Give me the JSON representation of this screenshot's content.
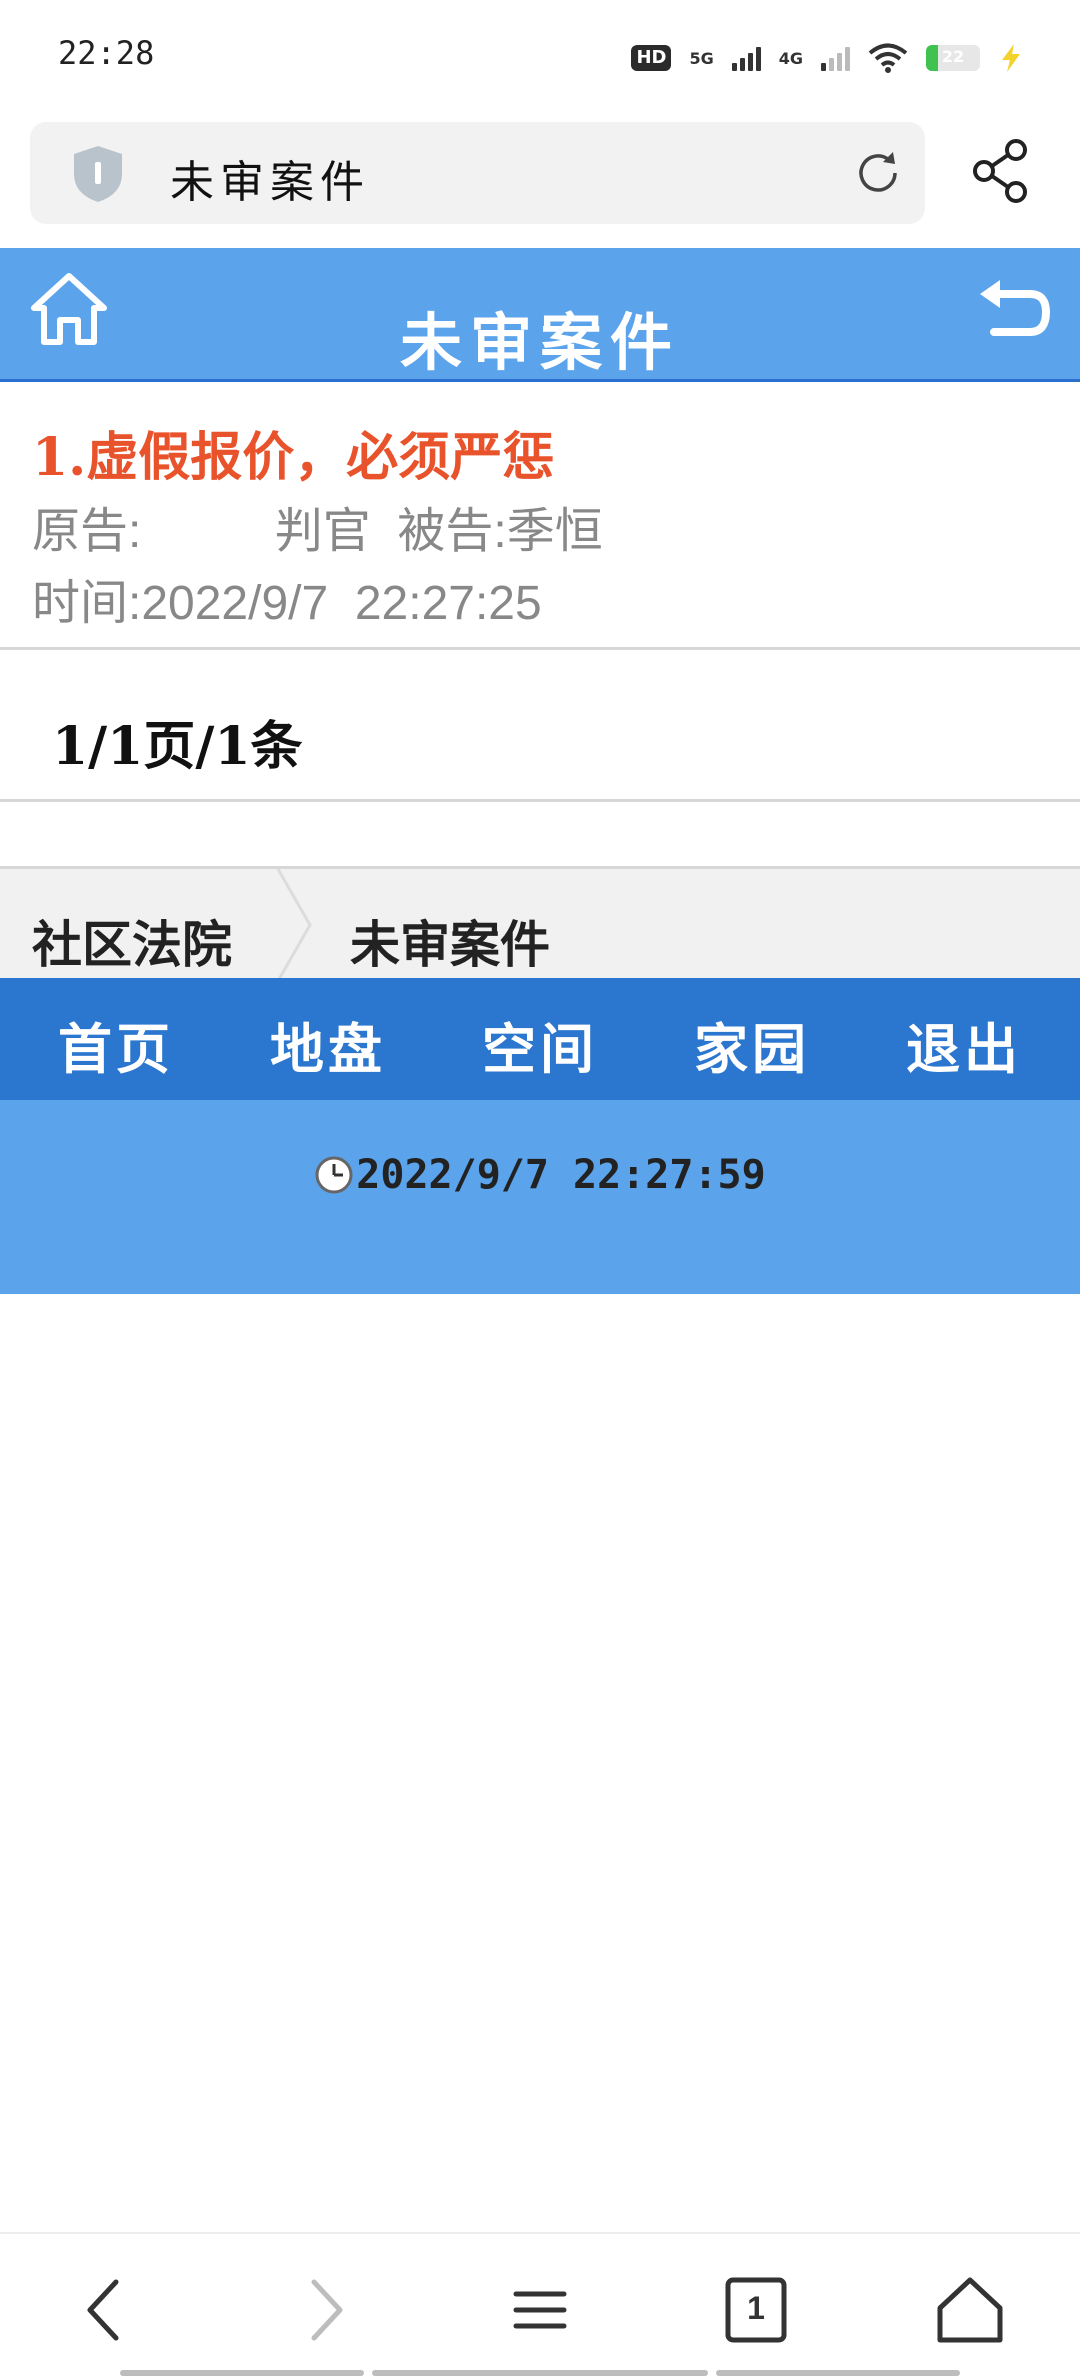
{
  "status_bar": {
    "time": "22:28",
    "hd_badge": "HD",
    "network_5g": "5G",
    "network_4g": "4G",
    "battery_level": "22",
    "battery_fraction": 0.22,
    "battery_color": "#3fc24f"
  },
  "browser": {
    "address_title": "未审案件"
  },
  "header": {
    "title": "未审案件",
    "color": "#5ba3ea"
  },
  "case_list": [
    {
      "title": "1.虚假报价，必须严惩",
      "plaintiff_line": "原告:          判官  被告:季恒",
      "time_line": "时间:2022/9/7  22:27:25",
      "title_color": "#e9532c"
    }
  ],
  "pagination": {
    "text": "1/1页/1条"
  },
  "breadcrumb": {
    "items": [
      "社区法院",
      "未审案件"
    ]
  },
  "nav": {
    "items": [
      "首页",
      "地盘",
      "空间",
      "家园",
      "退出"
    ],
    "color": "#2b76cf"
  },
  "footer": {
    "time": "2022/9/7 22:27:59"
  },
  "bottom_nav": {
    "tab_count": "1"
  }
}
